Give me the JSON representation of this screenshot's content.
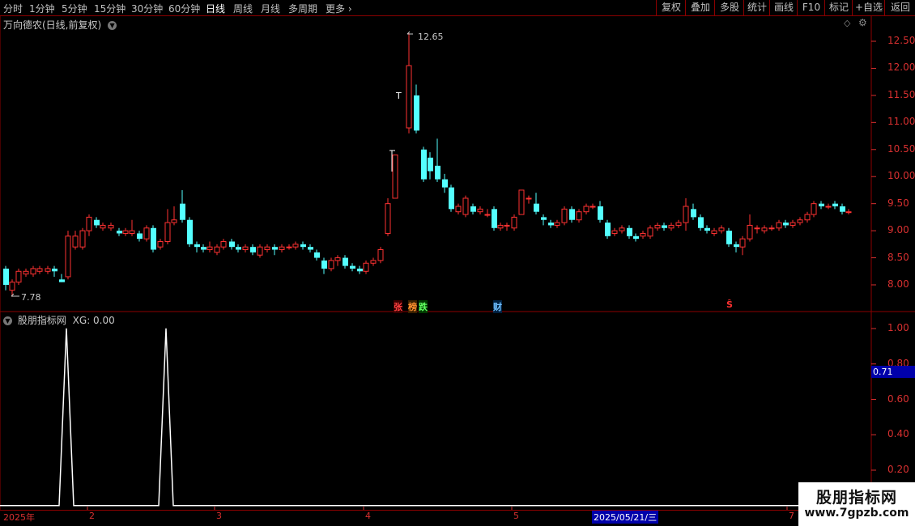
{
  "toolbar": {
    "periods": [
      "分时",
      "1分钟",
      "5分钟",
      "15分钟",
      "30分钟",
      "60分钟",
      "日线",
      "周线",
      "月线",
      "多周期"
    ],
    "active_period": "日线",
    "more": "更多",
    "right_buttons": [
      "复权",
      "叠加",
      "多股",
      "统计",
      "画线",
      "F10",
      "标记",
      "+自选",
      "返回"
    ]
  },
  "main_chart": {
    "title": "万向德农(日线,前复权)",
    "y_ticks": [
      "12.50",
      "12.00",
      "11.50",
      "11.00",
      "10.50",
      "10.00",
      "9.50",
      "9.00",
      "8.50",
      "8.00"
    ],
    "high_label": "12.65",
    "low_label": "7.78",
    "markers": {
      "zhang": "张",
      "bang": "榜",
      "die": "跌",
      "cai": "财",
      "s": "Ŝ"
    },
    "t_marker": "T",
    "colors": {
      "up": "#ff3232",
      "down": "#54ffff",
      "grid": "#8b0000"
    }
  },
  "chart_data": {
    "type": "line",
    "title": "股朋指标网 XG: 0.00",
    "x": [
      "2025年",
      "2",
      "3",
      "4",
      "5",
      "2025/05/21/三",
      "7"
    ],
    "ylim": [
      0,
      1.05
    ],
    "y_ticks": [
      "1.00",
      "0.80",
      "0.60",
      "0.40",
      "0.20"
    ],
    "series": [
      {
        "name": "XG",
        "spikes_at_bar": [
          9,
          24
        ],
        "values": [
          0,
          1,
          0,
          1,
          0
        ]
      }
    ],
    "current_value": "0.71"
  },
  "indicator": {
    "title": "股朋指标网",
    "xg_label": "XG: 0.00",
    "cursor_value": "0.71",
    "y_ticks": [
      "1.00",
      "0.80",
      "0.60",
      "0.40",
      "0.20"
    ]
  },
  "x_axis": {
    "labels": [
      "2025年",
      "2",
      "3",
      "4",
      "5",
      "7"
    ],
    "cursor_date": "2025/05/21/三"
  },
  "watermark": {
    "title": "股朋指标网",
    "url": "www.7gpzb.com"
  }
}
